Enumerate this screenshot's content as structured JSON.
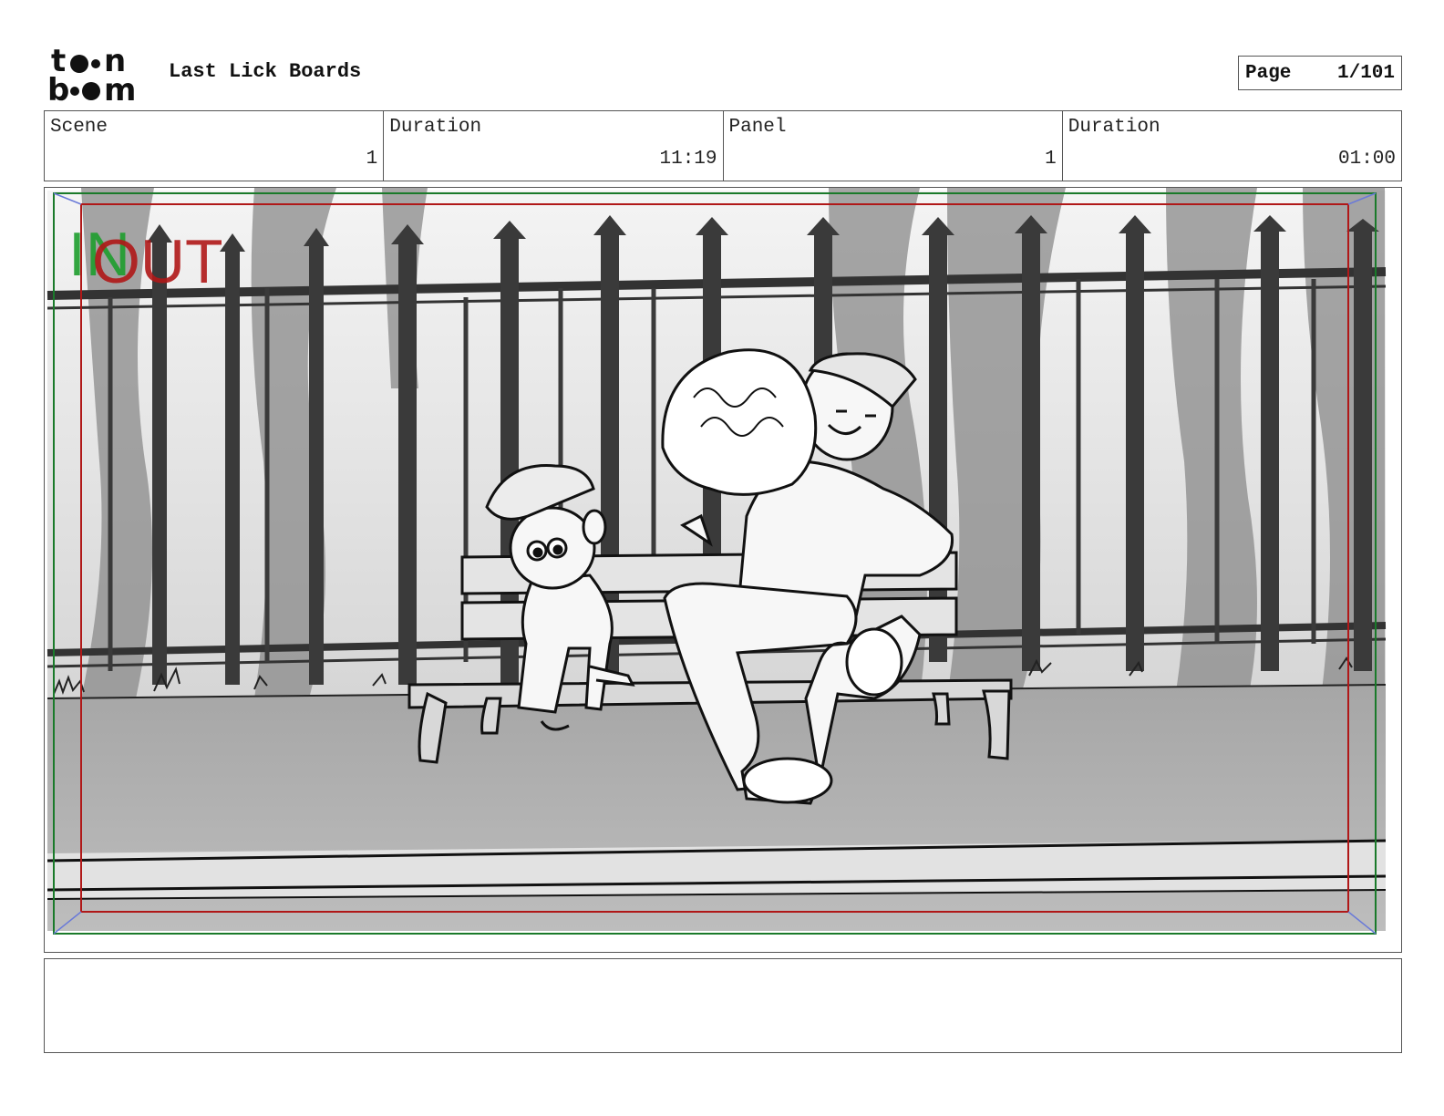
{
  "header": {
    "logo_alt": "toon boom",
    "title": "Last Lick Boards",
    "page_label": "Page",
    "page_value": "1/101"
  },
  "info": {
    "scene_label": "Scene",
    "scene_value": "1",
    "scene_duration_label": "Duration",
    "scene_duration_value": "11:19",
    "panel_label": "Panel",
    "panel_value": "1",
    "panel_duration_label": "Duration",
    "panel_duration_value": "01:00"
  },
  "panel": {
    "in_marker": "IN",
    "out_marker": "OUT",
    "in_color": "#1e9e2e",
    "out_color": "#b01818"
  },
  "notes": {
    "text": ""
  }
}
